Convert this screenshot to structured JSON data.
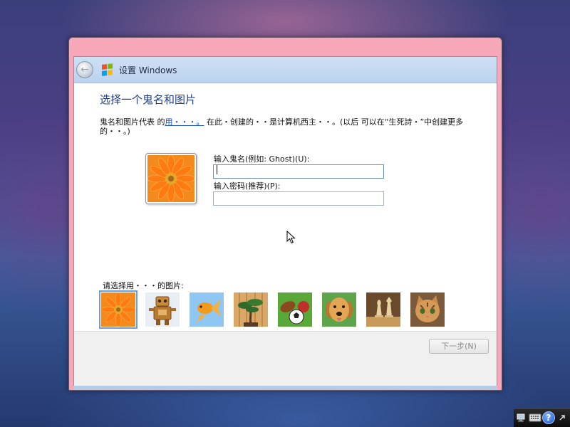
{
  "window": {
    "title": "设置 Windows",
    "back_glyph": "←"
  },
  "page": {
    "heading": "选择一个鬼名和图片",
    "description_start": "鬼名和图片代表  的",
    "description_link": "用・・・。",
    "description_end": "  在此・创建的・・是计算机西主・・。(以后  可以在“生死詩・”中创建更多的・・。)"
  },
  "form": {
    "username_label": "输入鬼名(例如: Ghost)(U):",
    "username_value": "",
    "password_label": "输入密码(推荐)(P):",
    "password_value": ""
  },
  "pictures": {
    "label": "请选择用・・・的图片:",
    "items": [
      {
        "name": "flower",
        "selected": true
      },
      {
        "name": "robot",
        "selected": false
      },
      {
        "name": "goldfish",
        "selected": false
      },
      {
        "name": "bonsai",
        "selected": false
      },
      {
        "name": "balls",
        "selected": false
      },
      {
        "name": "dog",
        "selected": false
      },
      {
        "name": "chess",
        "selected": false
      },
      {
        "name": "kitten",
        "selected": false
      }
    ]
  },
  "footer": {
    "next_label": "下一步(N)",
    "next_enabled": false
  },
  "tray": {
    "icons": [
      "network-icon",
      "keyboard-icon",
      "help-icon"
    ],
    "help_glyph": "?"
  },
  "colors": {
    "accent": "#1e3b8a",
    "window_frame": "#f6a7b8",
    "titlebar": "#bcd2ee",
    "link": "#1850c8"
  }
}
